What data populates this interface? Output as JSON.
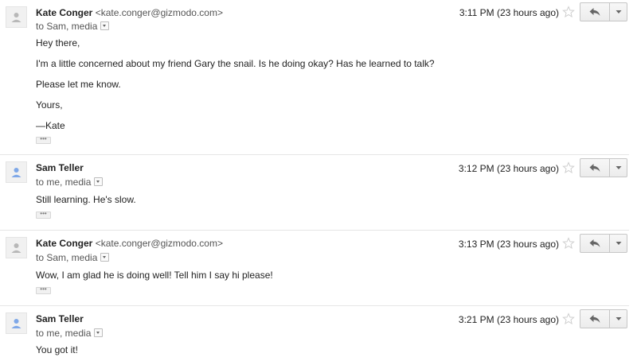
{
  "messages": [
    {
      "sender_name": "Kate Conger",
      "sender_email": "<kate.conger@gizmodo.com>",
      "recipients": "to Sam, media",
      "time": "3:11 PM (23 hours ago)",
      "body": [
        "Hey there,",
        "I'm a little concerned about my friend Gary the snail. Is he doing okay? Has he learned to talk?",
        "Please let me know.",
        "Yours,",
        "—Kate"
      ],
      "trimmed_label": "•••",
      "avatar_color": "#b8b8b8"
    },
    {
      "sender_name": "Sam Teller",
      "sender_email": "",
      "recipients": "to me, media",
      "time": "3:12 PM (23 hours ago)",
      "body": [
        "Still learning. He's slow."
      ],
      "trimmed_label": "•••",
      "avatar_color": "#7fa8e8"
    },
    {
      "sender_name": "Kate Conger",
      "sender_email": "<kate.conger@gizmodo.com>",
      "recipients": "to Sam, media",
      "time": "3:13 PM (23 hours ago)",
      "body": [
        "Wow, I am glad he is doing well! Tell him I say hi please!"
      ],
      "trimmed_label": "•••",
      "avatar_color": "#b8b8b8"
    },
    {
      "sender_name": "Sam Teller",
      "sender_email": "",
      "recipients": "to me, media",
      "time": "3:21 PM (23 hours ago)",
      "body": [
        "You got it!"
      ],
      "trimmed_label": "",
      "avatar_color": "#7fa8e8"
    }
  ],
  "icons": {
    "avatar": "person-silhouette-icon",
    "star": "star-outline-icon",
    "reply": "reply-arrow-icon",
    "more": "triangle-down-icon",
    "details": "details-dropdown-icon"
  }
}
